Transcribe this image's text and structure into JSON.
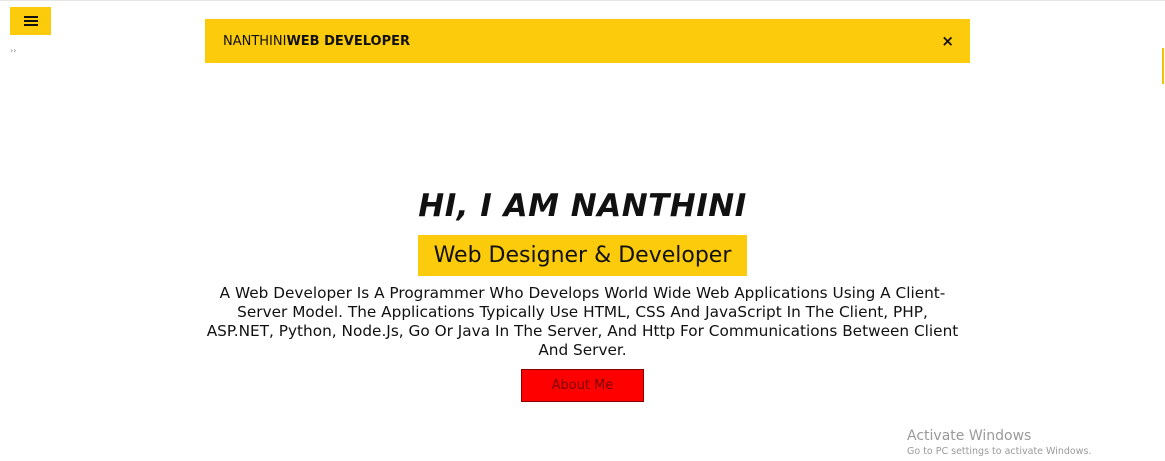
{
  "header": {
    "menu_icon": "hamburger-menu-icon",
    "small_mark": "››"
  },
  "navbar": {
    "brand_name": "NANTHINI",
    "brand_role": "WEB DEVELOPER",
    "close_label": "×"
  },
  "hero": {
    "title": "HI, I AM NANTHINI",
    "subtitle": "Web Designer & Developer",
    "description": "A Web Developer Is A Programmer Who Develops World Wide Web Applications Using A Client-Server Model. The Applications Typically Use HTML, CSS And JavaScript In The Client, PHP, ASP.NET, Python, Node.Js, Go Or Java In The Server, And Http For Communications Between Client And Server.",
    "button_label": "About Me"
  },
  "watermark": {
    "title": "Activate Windows",
    "subtitle": "Go to PC settings to activate Windows."
  },
  "colors": {
    "accent_yellow": "#fccb0c",
    "button_red": "#ff0000"
  }
}
